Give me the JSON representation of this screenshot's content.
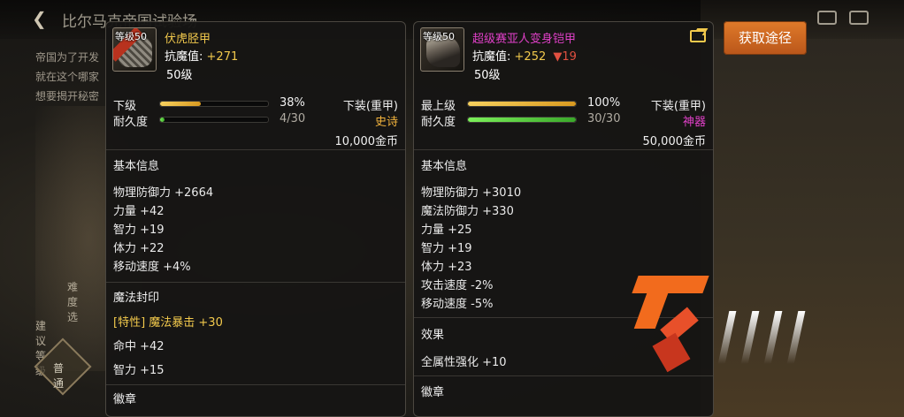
{
  "header": {
    "title": "比尔马克帝国试验场"
  },
  "background_text": [
    "帝国为了开发",
    "就在这个哪家",
    "想要揭开秘密"
  ],
  "side": {
    "tag_label": "难度选",
    "group_label": "建议等级",
    "button_label": "普通"
  },
  "left_item": {
    "level_tag": "等级50",
    "name": "伏虎胫甲",
    "name_color": "#f2c94c",
    "resist_label": "抗魔值:",
    "resist_value": "+271",
    "level_text": "50级",
    "grade_label": "下级",
    "grade_fill": 0.38,
    "grade_pct": "38%",
    "slot_type": "下装(重甲)",
    "durability_label": "耐久度",
    "durability_fill": 0.04,
    "durability_value": "4/30",
    "rarity": "史诗",
    "price": "10,000金币",
    "basic_title": "基本信息",
    "basic_stats": [
      "物理防御力 +2664",
      "力量 +42",
      "智力 +19",
      "体力 +22",
      "移动速度 +4%"
    ],
    "seal_title": "魔法封印",
    "seal_stats": [
      "[特性] 魔法暴击 +30",
      "命中 +42",
      "智力 +15"
    ],
    "emblem_title": "徽章"
  },
  "right_item": {
    "level_tag": "等级50",
    "name": "超级赛亚人变身铠甲",
    "name_color": "#e040c8",
    "resist_label": "抗魔值:",
    "resist_value": "+252",
    "resist_delta": "▼19",
    "level_text": "50级",
    "grade_label": "最上级",
    "grade_fill": 1.0,
    "grade_pct": "100%",
    "slot_type": "下装(重甲)",
    "durability_label": "耐久度",
    "durability_fill": 1.0,
    "durability_value": "30/30",
    "rarity": "神器",
    "price": "50,000金币",
    "basic_title": "基本信息",
    "basic_stats": [
      "物理防御力 +3010",
      "魔法防御力 +330",
      "力量 +25",
      "智力 +19",
      "体力 +23",
      "攻击速度 -2%",
      "移动速度 -5%"
    ],
    "effect_title": "效果",
    "effect_stats": [
      "全属性强化 +10"
    ],
    "emblem_title": "徽章"
  },
  "get_button": {
    "label": "获取途径"
  }
}
